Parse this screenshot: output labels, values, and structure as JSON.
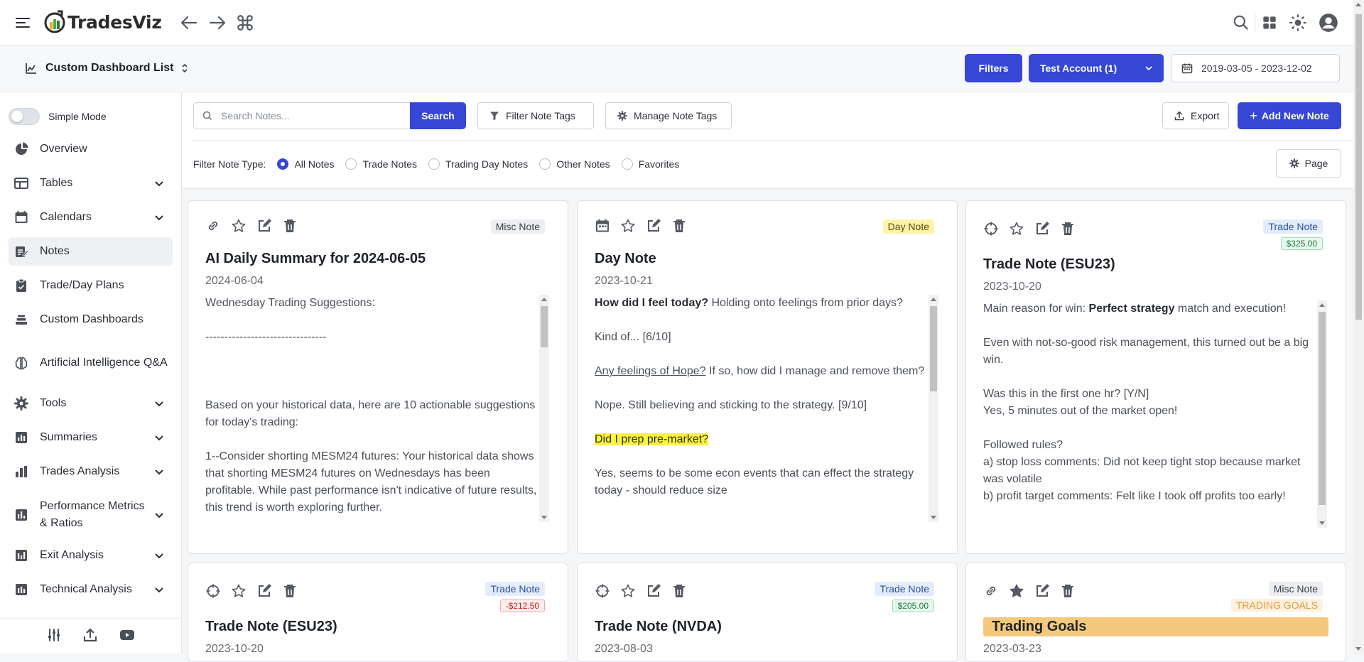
{
  "app": {
    "name": "TradesViz"
  },
  "subheader": {
    "dashboard_title": "Custom Dashboard List",
    "filters_label": "Filters",
    "account_label": "Test Account (1)",
    "date_range": "2019-03-05 - 2023-12-02"
  },
  "sidebar": {
    "simple_mode_label": "Simple Mode",
    "items": [
      {
        "label": "Overview"
      },
      {
        "label": "Tables"
      },
      {
        "label": "Calendars"
      },
      {
        "label": "Notes"
      },
      {
        "label": "Trade/Day Plans"
      },
      {
        "label": "Custom Dashboards"
      },
      {
        "label": "Artificial Intelligence Q&A"
      },
      {
        "label": "Tools"
      },
      {
        "label": "Summaries"
      },
      {
        "label": "Trades Analysis"
      },
      {
        "label": "Performance Metrics & Ratios"
      },
      {
        "label": "Exit Analysis"
      },
      {
        "label": "Technical Analysis"
      }
    ]
  },
  "toolbar": {
    "search_placeholder": "Search Notes...",
    "search_label": "Search",
    "filter_tags_label": "Filter Note Tags",
    "manage_tags_label": "Manage Note Tags",
    "export_label": "Export",
    "add_note_label": "Add New Note",
    "filter_type_label": "Filter Note Type:",
    "note_types": [
      "All Notes",
      "Trade Notes",
      "Trading Day Notes",
      "Other Notes",
      "Favorites"
    ],
    "selected_note_type": "All Notes",
    "page_label": "Page"
  },
  "notes": [
    {
      "badge": "Misc Note",
      "title": "AI Daily Summary for 2024-06-05",
      "date": "2024-06-04",
      "body": [
        "Wednesday Trading Suggestions:",
        "--------------------------------",
        "",
        "Based on your historical data, here are 10 actionable suggestions for today's trading:",
        "1--Consider shorting MESM24 futures: Your historical data shows that shorting MESM24 futures on Wednesdays has been profitable. While past performance isn't indicative of future results, this trend is worth exploring further."
      ]
    },
    {
      "badge": "Day Note",
      "title": "Day Note",
      "date": "2023-10-21",
      "b1_bold": "How did I feel today?",
      "b1_rest": " Holding onto feelings from prior days?",
      "b2": "Kind of... [6/10]",
      "b3_u": "Any feelings of Hope?",
      "b3_rest": " If so, how did I manage and remove them?",
      "b4": "Nope. Still believing and sticking to the strategy. [9/10]",
      "b5_hl": "Did I prep pre-market?",
      "b6": "Yes, seems to be some econ events that can effect the strategy today - should reduce size"
    },
    {
      "badge": "Trade Note",
      "amount": "$325.00",
      "title": "Trade Note (ESU23)",
      "date": "2023-10-20",
      "b1_pre": "Main reason for win: ",
      "b1_bold": "Perfect strategy",
      "b1_rest": " match and execution!",
      "b2": "Even with not-so-good risk management, this turned out be a big win.",
      "b3": "Was this in the first one hr? [Y/N]",
      "b3b": "Yes, 5 minutes out of the market open!",
      "b4": "Followed rules?",
      "b4a": "a) stop loss comments: Did not keep tight stop because market was volatile",
      "b4b": "b) profit target comments: Felt like I took off profits too early!"
    },
    {
      "badge": "Trade Note",
      "amount": "-$212.50",
      "title": "Trade Note (ESU23)",
      "date": "2023-10-20"
    },
    {
      "badge": "Trade Note",
      "amount": "$205.00",
      "title": "Trade Note (NVDA)",
      "date": "2023-08-03"
    },
    {
      "badge": "Misc Note",
      "tag": "TRADING GOALS",
      "title": "Trading Goals",
      "date": "2023-03-23"
    }
  ],
  "colors": {
    "primary": "#3547d4",
    "goals_highlight": "#f5c97d",
    "day_badge": "#fff3a9"
  }
}
